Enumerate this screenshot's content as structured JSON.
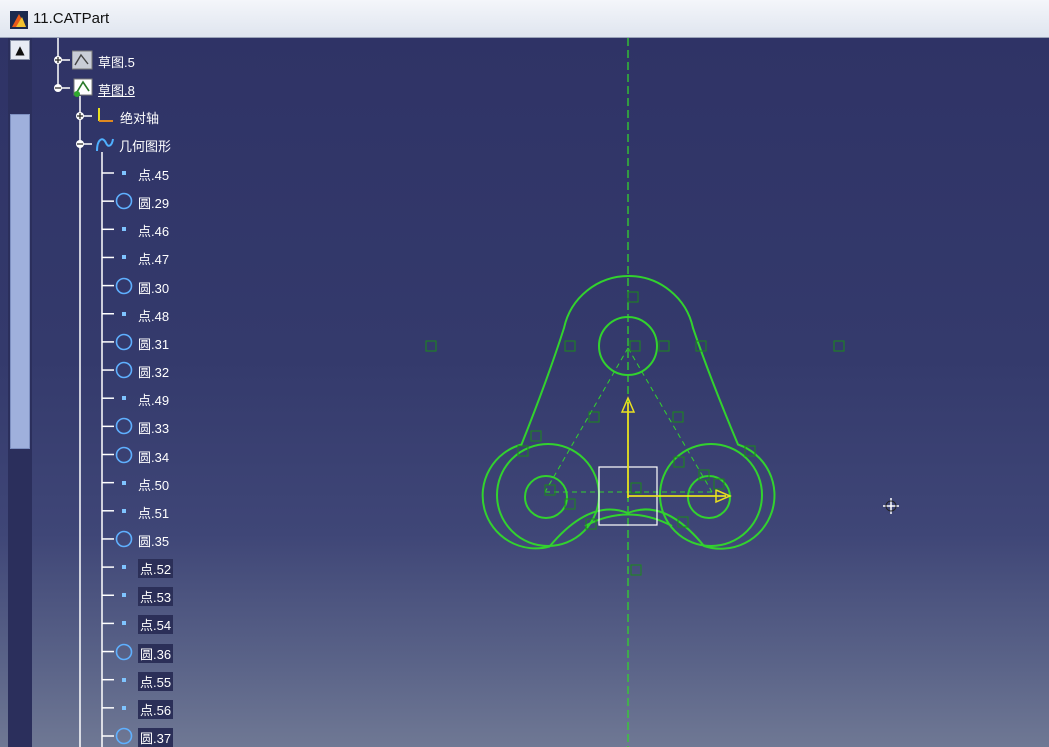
{
  "window": {
    "title": "11.CATPart",
    "app_icon": "catia-part-icon"
  },
  "colors": {
    "sketch_green": "#32d22e",
    "axis_yellow": "#e8e020",
    "tree_line": "#ffffff",
    "background_top": "#2f3366",
    "background_bottom": "#6f7894"
  },
  "tree": {
    "top_items": [
      {
        "label": "草图.5",
        "icon": "sketch-icon",
        "expander": "plus"
      },
      {
        "label": "草图.8",
        "icon": "sketch-active-icon",
        "expander": "minus"
      },
      {
        "label": "绝对轴",
        "icon": "axis-system-icon",
        "expander": "plus"
      },
      {
        "label": "几何图形",
        "icon": "geometry-icon",
        "expander": "minus"
      }
    ],
    "geometry_items": [
      {
        "label": "点.45",
        "icon": "point-icon"
      },
      {
        "label": "圆.29",
        "icon": "circle-icon"
      },
      {
        "label": "点.46",
        "icon": "point-icon"
      },
      {
        "label": "点.47",
        "icon": "point-icon"
      },
      {
        "label": "圆.30",
        "icon": "circle-icon"
      },
      {
        "label": "点.48",
        "icon": "point-icon"
      },
      {
        "label": "圆.31",
        "icon": "circle-icon"
      },
      {
        "label": "圆.32",
        "icon": "circle-icon"
      },
      {
        "label": "点.49",
        "icon": "point-icon"
      },
      {
        "label": "圆.33",
        "icon": "circle-icon"
      },
      {
        "label": "圆.34",
        "icon": "circle-icon"
      },
      {
        "label": "点.50",
        "icon": "point-icon"
      },
      {
        "label": "点.51",
        "icon": "point-icon"
      },
      {
        "label": "圆.35",
        "icon": "circle-icon"
      },
      {
        "label": "点.52",
        "icon": "point-icon"
      },
      {
        "label": "点.53",
        "icon": "point-icon"
      },
      {
        "label": "点.54",
        "icon": "point-icon"
      },
      {
        "label": "圆.36",
        "icon": "circle-icon"
      },
      {
        "label": "点.55",
        "icon": "point-icon"
      },
      {
        "label": "点.56",
        "icon": "point-icon"
      },
      {
        "label": "圆.37",
        "icon": "circle-icon"
      }
    ]
  },
  "scrollbar": {
    "up_arrow": "▲",
    "thumb_fraction_start": 0.11,
    "thumb_fraction_size": 0.47
  },
  "canvas": {
    "cursor_icon": "move-cursor-icon",
    "constraint_symbol": "constraint-icon"
  }
}
